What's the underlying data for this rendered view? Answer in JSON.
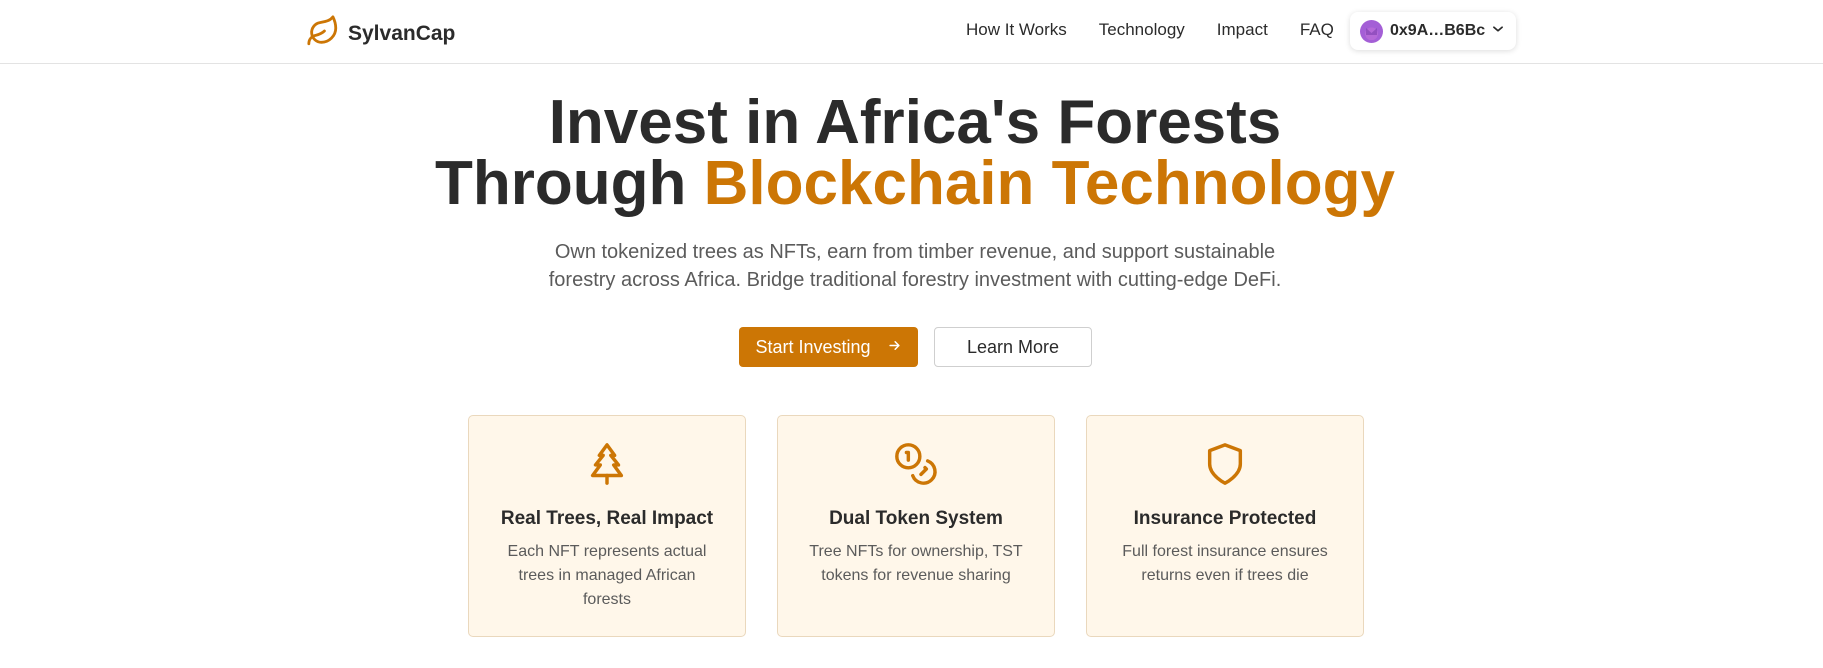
{
  "header": {
    "brand": "SylvanCap",
    "logo_icon": "leaf-icon",
    "nav": [
      "How It Works",
      "Technology",
      "Impact",
      "FAQ"
    ],
    "wallet": {
      "address": "0x9A…B6Bc",
      "avatar_color": "#a45fd6",
      "chevron_icon": "chevron-down-icon"
    }
  },
  "hero": {
    "title_line1": "Invest in Africa's Forests",
    "title_line2_plain": "Through ",
    "title_line2_accent": "Blockchain Technology",
    "subtitle": "Own tokenized trees as NFTs, earn from timber revenue, and support sustainable forestry across Africa. Bridge traditional forestry investment with cutting-edge DeFi.",
    "primary_button": "Start Investing",
    "primary_button_icon": "arrow-right-icon",
    "secondary_button": "Learn More"
  },
  "features": [
    {
      "icon": "tree-icon",
      "title": "Real Trees, Real Impact",
      "description": "Each NFT represents actual trees in managed African forests"
    },
    {
      "icon": "coins-icon",
      "title": "Dual Token System",
      "description": "Tree NFTs for ownership, TST tokens for revenue sharing"
    },
    {
      "icon": "shield-icon",
      "title": "Insurance Protected",
      "description": "Full forest insurance ensures returns even if trees die"
    }
  ],
  "colors": {
    "accent": "#cc7605",
    "card_background": "#fff7ea",
    "text": "#2b2b2b",
    "muted_text": "#5b5b5b"
  }
}
